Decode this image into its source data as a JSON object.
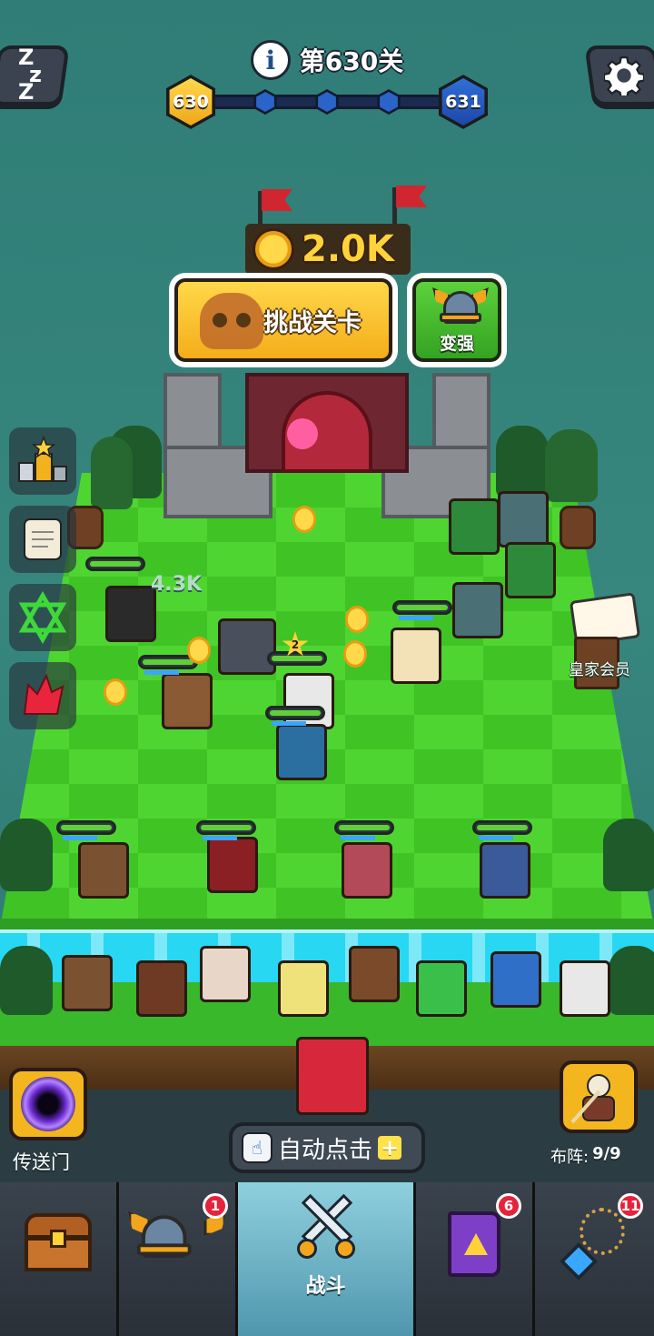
{
  "header": {
    "level_title": "第630关",
    "current_level": "630",
    "next_level": "631",
    "info_icon": "i"
  },
  "reward": {
    "amount": "2.0K"
  },
  "actions": {
    "challenge_label": "挑战关卡",
    "upgrade_label": "变强"
  },
  "battle": {
    "damage_text": "4.3K",
    "unit_star_level": "2"
  },
  "sidebar": {
    "items": [
      {
        "name": "ranking-icon"
      },
      {
        "name": "quest-scroll-icon"
      },
      {
        "name": "hexagram-icon"
      },
      {
        "name": "red-leaf-icon"
      }
    ]
  },
  "royal": {
    "label": "皇家会员"
  },
  "portal": {
    "label": "传送门"
  },
  "formation": {
    "label": "布阵:",
    "count": "9/9"
  },
  "autoclick": {
    "label": "自动点击",
    "plus": "+"
  },
  "nav": {
    "tabs": [
      {
        "id": "treasure",
        "label": "",
        "badge": ""
      },
      {
        "id": "heroes",
        "label": "",
        "badge": "1"
      },
      {
        "id": "battle",
        "label": "战斗",
        "badge": "",
        "active": true
      },
      {
        "id": "spellbook",
        "label": "",
        "badge": "6"
      },
      {
        "id": "equipment",
        "label": "",
        "badge": "11"
      }
    ]
  },
  "colors": {
    "background": "#37877e",
    "board_light": "#4fd531",
    "board_dark": "#3fc325",
    "accent_gold": "#f4ad1a",
    "badge_red": "#e5233b",
    "nav_active": "#8fd0de"
  }
}
